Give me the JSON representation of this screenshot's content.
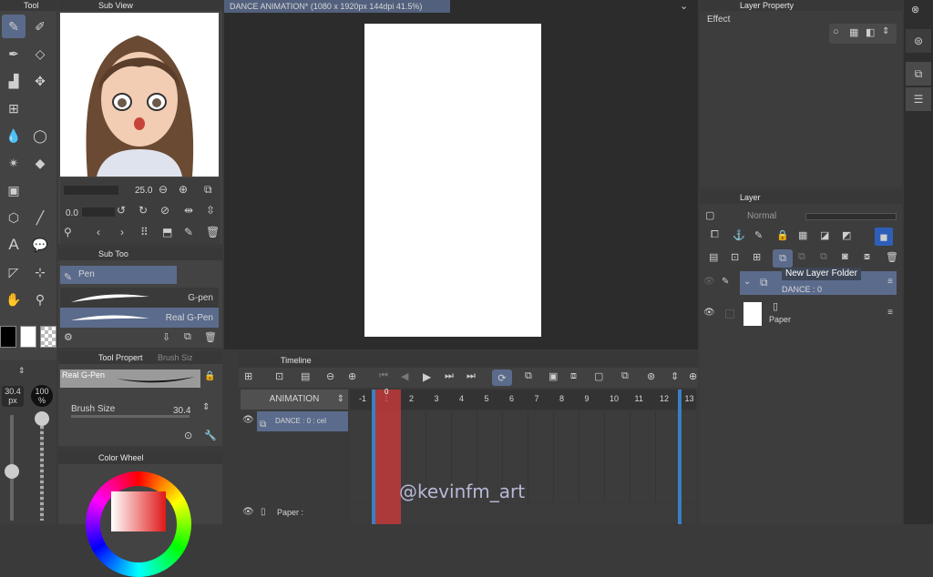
{
  "toolbox": {
    "title": "Tool",
    "size_value": "30.4",
    "size_unit": "px",
    "opacity_value": "100",
    "opacity_unit": "%"
  },
  "subview": {
    "title": "Sub View",
    "zoom_value": "25.0",
    "rotate_value": "0.0"
  },
  "subtool": {
    "title": "Sub Too",
    "group": "Pen",
    "items": [
      "G-pen",
      "Real G-Pen"
    ]
  },
  "tool_property": {
    "title": "Tool Propert",
    "tab2": "Brush Siz",
    "brush_name": "Real G-Pen",
    "brush_size_label": "Brush Size",
    "brush_size_value": "30.4"
  },
  "color_wheel": {
    "title": "Color Wheel"
  },
  "canvas": {
    "tab_title": "DANCE ANIMATION* (1080 x 1920px 144dpi 41.5%)"
  },
  "timeline": {
    "title": "Timeline",
    "animation_label": "ANIMATION",
    "frames": [
      "-1",
      "1",
      "2",
      "3",
      "4",
      "5",
      "6",
      "7",
      "8",
      "9",
      "10",
      "11",
      "12",
      "13"
    ],
    "playhead": "0",
    "tracks": [
      "DANCE : 0 : cel",
      "Paper :"
    ],
    "watermark": "@kevinfm_art"
  },
  "layer_property": {
    "title": "Layer Property",
    "effect_label": "Effect"
  },
  "layer_panel": {
    "title": "Layer",
    "blend_mode": "Normal",
    "tooltip": "New Layer Folder",
    "layers": [
      {
        "name": "DANCE : 0"
      },
      {
        "name": "Paper"
      }
    ]
  },
  "colors": {
    "accent": "#5b6b8c",
    "playhead": "#c0393b",
    "frame_marker": "#3a7fc4"
  }
}
